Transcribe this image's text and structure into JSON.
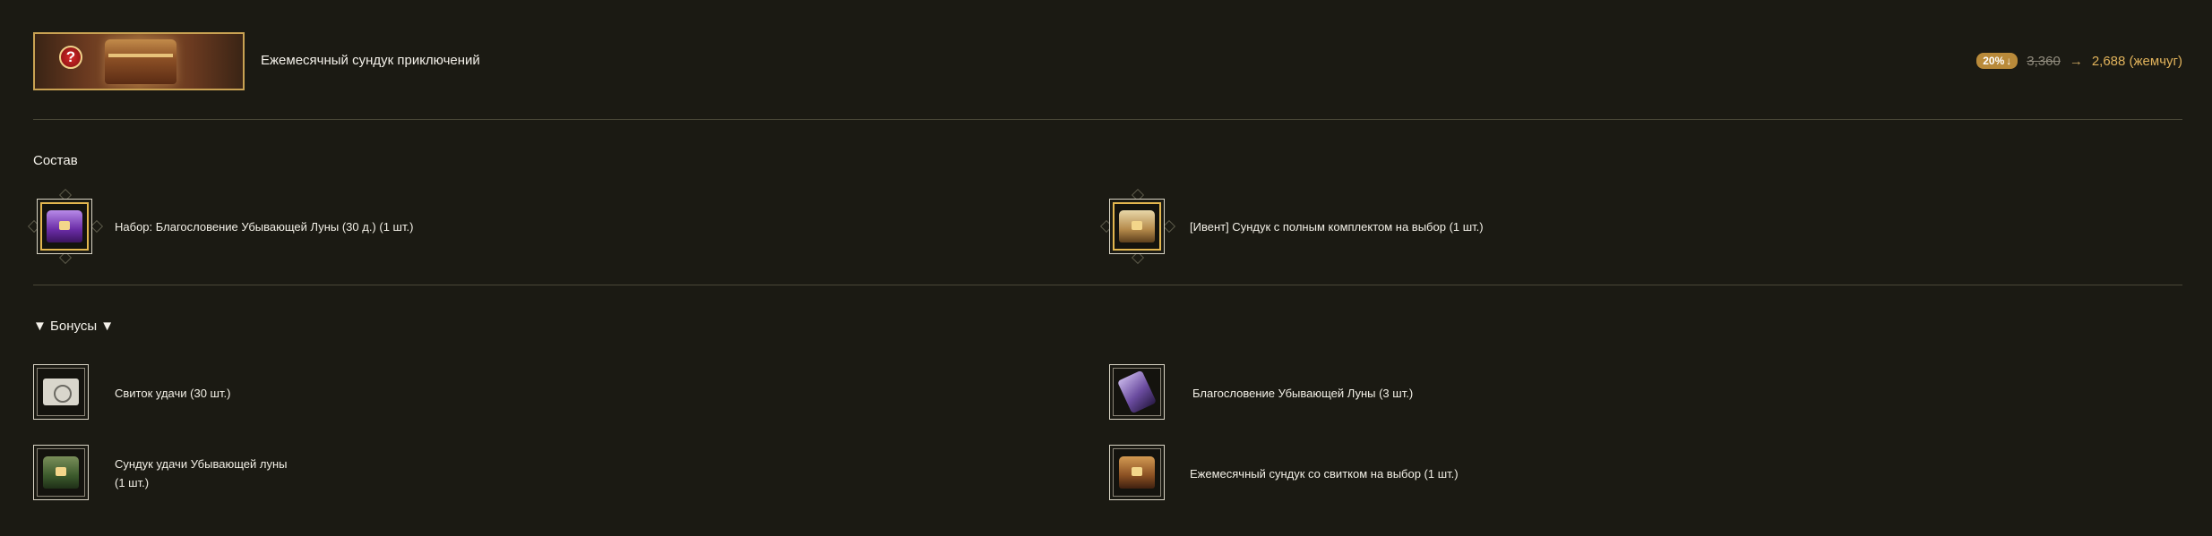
{
  "header": {
    "title": "Ежемесячный сундук приключений",
    "hero_icon": "mystery-chest-icon"
  },
  "price": {
    "discount": "20%",
    "discount_icon": "down-arrow-icon",
    "old_price": "3,360",
    "arrow": "→",
    "new_price": "2,688 (жемчуг)"
  },
  "composition": {
    "title": "Состав",
    "items": [
      {
        "label": "Набор: Благословение Убывающей Луны (30 д.) (1 шт.)",
        "icon": "purple-gift-box-icon"
      },
      {
        "label": "[Ивент] Сундук с полным комплектом на выбор (1 шт.)",
        "icon": "gold-chest-icon"
      }
    ]
  },
  "bonuses": {
    "title": "▼ Бонусы ▼",
    "items": [
      {
        "label": "Свиток удачи (30 шт.)",
        "icon": "luck-scroll-icon"
      },
      {
        "label": "Благословение Убывающей Луны (3 шт.)",
        "icon": "moon-blessing-icon"
      },
      {
        "label_line1": "Сундук удачи Убывающей луны",
        "label_line2": "(1 шт.)",
        "icon": "green-luck-chest-icon"
      },
      {
        "label": "Ежемесячный сундук со свитком на выбор (1 шт.)",
        "icon": "monthly-chest-icon"
      }
    ]
  },
  "colors": {
    "background": "#1b1a13",
    "accent_gold": "#e0b25b",
    "badge": "#b98a3a",
    "divider": "#4a4838"
  }
}
